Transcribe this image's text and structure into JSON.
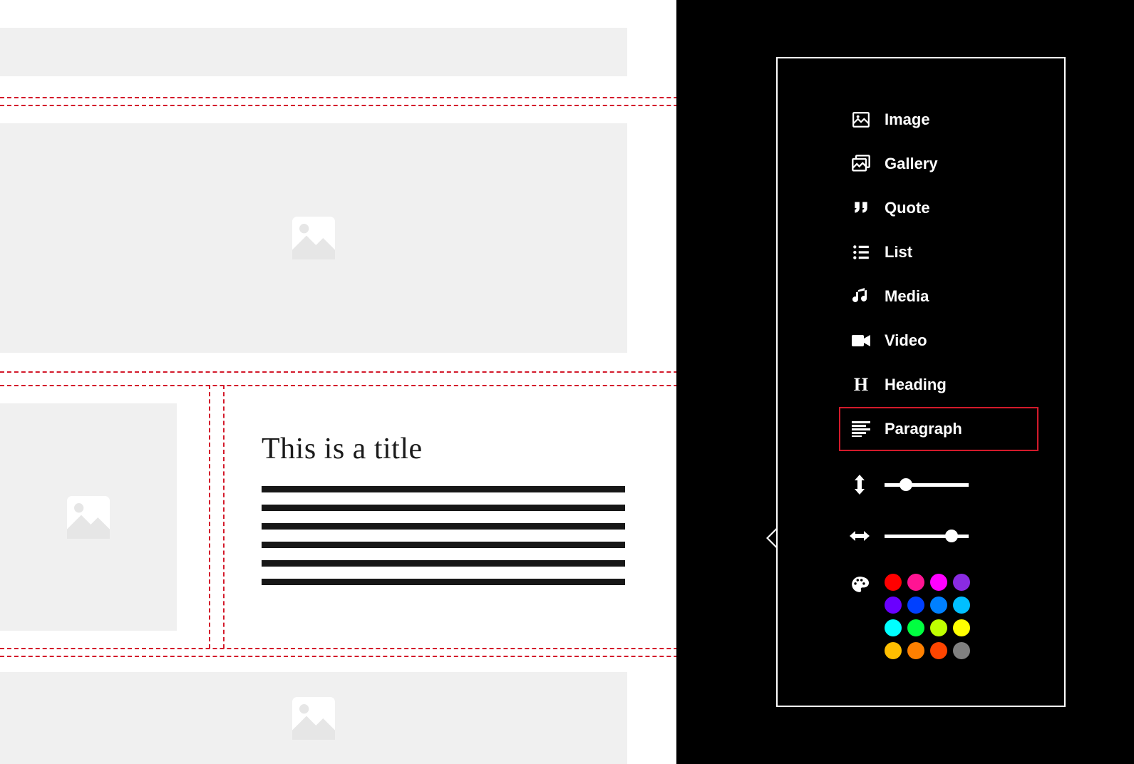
{
  "canvas": {
    "title": "This is a title"
  },
  "toolbox": {
    "items": [
      {
        "id": "image",
        "label": "Image"
      },
      {
        "id": "gallery",
        "label": "Gallery"
      },
      {
        "id": "quote",
        "label": "Quote"
      },
      {
        "id": "list",
        "label": "List"
      },
      {
        "id": "media",
        "label": "Media"
      },
      {
        "id": "video",
        "label": "Video"
      },
      {
        "id": "heading",
        "label": "Heading"
      },
      {
        "id": "paragraph",
        "label": "Paragraph"
      }
    ],
    "selected": "paragraph",
    "sliders": {
      "vertical": {
        "percent": 25
      },
      "horizontal": {
        "percent": 80
      }
    },
    "colors": [
      "#ff0000",
      "#ff1493",
      "#ff00ff",
      "#8a2be2",
      "#6a00ff",
      "#0040ff",
      "#0080ff",
      "#00bfff",
      "#00ffff",
      "#00ff40",
      "#bfff00",
      "#ffff00",
      "#ffbf00",
      "#ff8000",
      "#ff4500",
      "#808080"
    ]
  }
}
